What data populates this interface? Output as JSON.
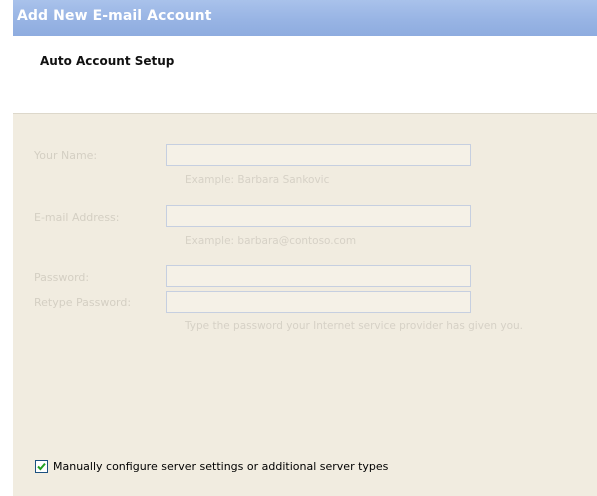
{
  "window": {
    "title": "Add New E-mail Account"
  },
  "header": {
    "title": "Auto Account Setup"
  },
  "form": {
    "name_label": "Your Name:",
    "name_value": "",
    "name_hint": "Example: Barbara Sankovic",
    "email_label": "E-mail Address:",
    "email_value": "",
    "email_hint": "Example: barbara@contoso.com",
    "password_label": "Password:",
    "password_value": "",
    "retype_label": "Retype Password:",
    "retype_value": "",
    "password_hint": "Type the password your Internet service provider has given you."
  },
  "manual_config": {
    "label": "Manually configure server settings or additional server types",
    "checked": true
  },
  "colors": {
    "titlebar": "#98b4e4",
    "dialog_bg": "#f1ece0",
    "disabled_text": "#d4cfc3",
    "field_border": "#c6cfe0",
    "checkmark": "#21a121"
  }
}
